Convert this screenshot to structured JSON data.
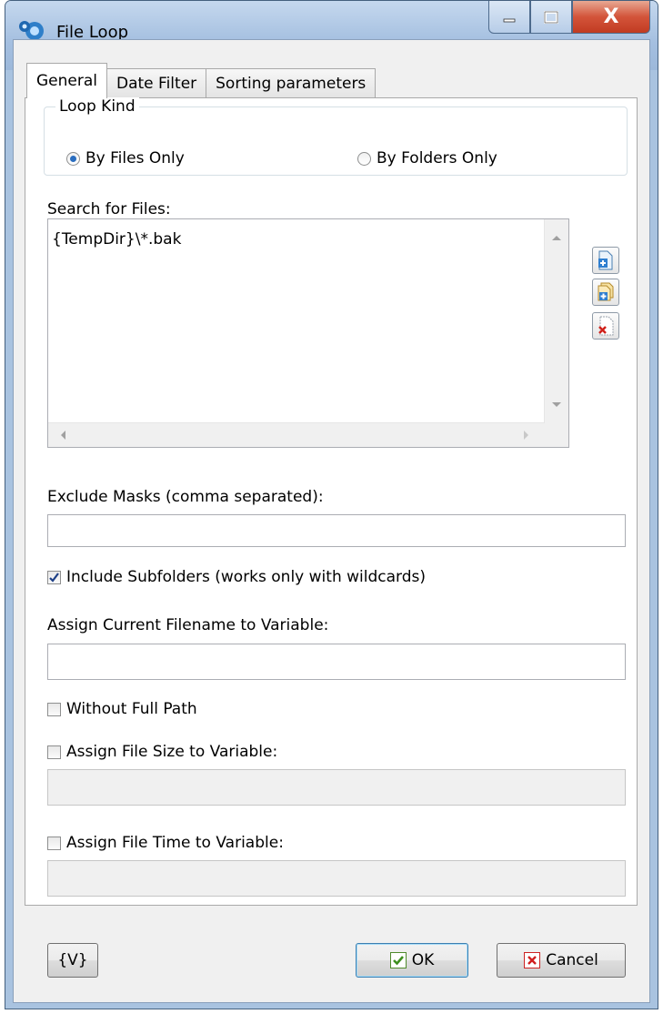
{
  "window": {
    "title": "File Loop",
    "caption_buttons": {
      "minimize": "minimize",
      "maximize": "maximize",
      "close": "X"
    }
  },
  "tabs": [
    "General",
    "Date Filter",
    "Sorting parameters"
  ],
  "loop_kind": {
    "legend": "Loop Kind",
    "options": [
      {
        "label": "By Files Only",
        "selected": true
      },
      {
        "label": "By Folders Only",
        "selected": false
      }
    ]
  },
  "search_files": {
    "label": "Search for Files:",
    "items": [
      "{TempDir}\\*.bak"
    ],
    "side_buttons": [
      "add-file-icon",
      "add-folder-icon",
      "delete-item-icon"
    ]
  },
  "exclude_masks": {
    "label": "Exclude Masks (comma separated):",
    "value": ""
  },
  "include_subfolders": {
    "label": "Include Subfolders (works only with wildcards)",
    "checked": true
  },
  "assign_filename": {
    "label": "Assign Current Filename to Variable:",
    "value": ""
  },
  "without_full_path": {
    "label": "Without Full Path",
    "checked": false
  },
  "assign_file_size": {
    "label": "Assign File Size to Variable:",
    "checked": false,
    "value": ""
  },
  "assign_file_time": {
    "label": "Assign File Time to Variable:",
    "checked": false,
    "value": ""
  },
  "footer": {
    "variables_button": "{V}",
    "ok": "OK",
    "cancel": "Cancel"
  }
}
